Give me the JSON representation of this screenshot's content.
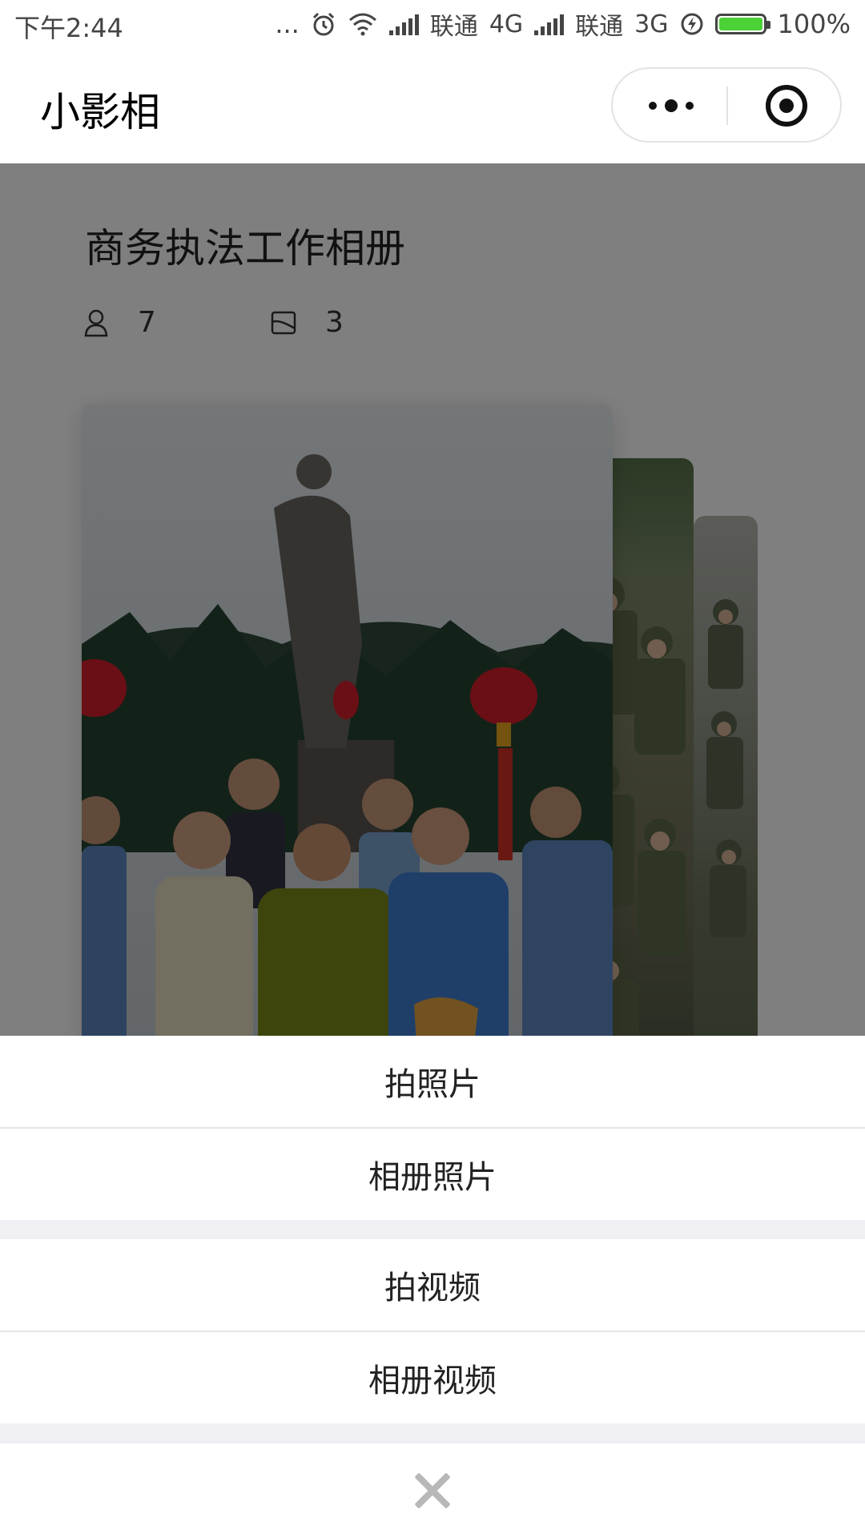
{
  "status_bar": {
    "time": "下午2:44",
    "dots": "...",
    "carrier1": "联通",
    "network1": "4G",
    "carrier2": "联通",
    "network2": "3G",
    "battery": "100%",
    "battery_level": 1.0,
    "icons": [
      "alarm-icon",
      "wifi-icon",
      "signal-icon",
      "charging-icon",
      "battery-icon"
    ]
  },
  "header": {
    "app_title": "小影相",
    "menu_icon": "more-dots-icon",
    "close_icon": "target-icon"
  },
  "album": {
    "title": "商务执法工作相册",
    "members": "7",
    "photos": "3"
  },
  "action_sheet": {
    "take_photo": "拍照片",
    "album_photo": "相册照片",
    "take_video": "拍视频",
    "album_video": "相册视频",
    "cancel_icon": "close-icon"
  },
  "colors": {
    "battery_green": "#4cd136",
    "mask": "rgba(0,0,0,0.5)",
    "sheet_gap": "#efeff4"
  }
}
